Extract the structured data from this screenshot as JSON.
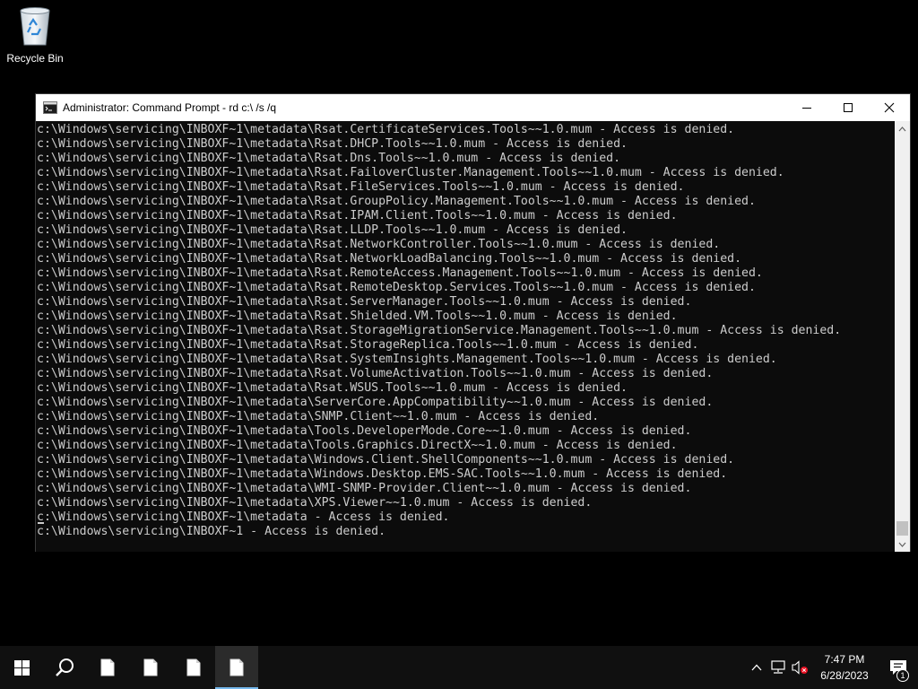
{
  "desktop": {
    "icons": [
      {
        "label": "Recycle Bin",
        "icon": "recycle-bin-icon"
      }
    ]
  },
  "window": {
    "title": "Administrator:  Command Prompt - rd  c:\\ /s /q",
    "icon": "command-prompt-icon",
    "controls": {
      "minimize": "minimize-icon",
      "maximize": "maximize-icon",
      "close": "close-icon"
    }
  },
  "console": {
    "lines": [
      "c:\\Windows\\servicing\\INBOXF~1\\metadata\\Rsat.CertificateServices.Tools~~1.0.mum - Access is denied.",
      "c:\\Windows\\servicing\\INBOXF~1\\metadata\\Rsat.DHCP.Tools~~1.0.mum - Access is denied.",
      "c:\\Windows\\servicing\\INBOXF~1\\metadata\\Rsat.Dns.Tools~~1.0.mum - Access is denied.",
      "c:\\Windows\\servicing\\INBOXF~1\\metadata\\Rsat.FailoverCluster.Management.Tools~~1.0.mum - Access is denied.",
      "c:\\Windows\\servicing\\INBOXF~1\\metadata\\Rsat.FileServices.Tools~~1.0.mum - Access is denied.",
      "c:\\Windows\\servicing\\INBOXF~1\\metadata\\Rsat.GroupPolicy.Management.Tools~~1.0.mum - Access is denied.",
      "c:\\Windows\\servicing\\INBOXF~1\\metadata\\Rsat.IPAM.Client.Tools~~1.0.mum - Access is denied.",
      "c:\\Windows\\servicing\\INBOXF~1\\metadata\\Rsat.LLDP.Tools~~1.0.mum - Access is denied.",
      "c:\\Windows\\servicing\\INBOXF~1\\metadata\\Rsat.NetworkController.Tools~~1.0.mum - Access is denied.",
      "c:\\Windows\\servicing\\INBOXF~1\\metadata\\Rsat.NetworkLoadBalancing.Tools~~1.0.mum - Access is denied.",
      "c:\\Windows\\servicing\\INBOXF~1\\metadata\\Rsat.RemoteAccess.Management.Tools~~1.0.mum - Access is denied.",
      "c:\\Windows\\servicing\\INBOXF~1\\metadata\\Rsat.RemoteDesktop.Services.Tools~~1.0.mum - Access is denied.",
      "c:\\Windows\\servicing\\INBOXF~1\\metadata\\Rsat.ServerManager.Tools~~1.0.mum - Access is denied.",
      "c:\\Windows\\servicing\\INBOXF~1\\metadata\\Rsat.Shielded.VM.Tools~~1.0.mum - Access is denied.",
      "c:\\Windows\\servicing\\INBOXF~1\\metadata\\Rsat.StorageMigrationService.Management.Tools~~1.0.mum - Access is denied.",
      "c:\\Windows\\servicing\\INBOXF~1\\metadata\\Rsat.StorageReplica.Tools~~1.0.mum - Access is denied.",
      "c:\\Windows\\servicing\\INBOXF~1\\metadata\\Rsat.SystemInsights.Management.Tools~~1.0.mum - Access is denied.",
      "c:\\Windows\\servicing\\INBOXF~1\\metadata\\Rsat.VolumeActivation.Tools~~1.0.mum - Access is denied.",
      "c:\\Windows\\servicing\\INBOXF~1\\metadata\\Rsat.WSUS.Tools~~1.0.mum - Access is denied.",
      "c:\\Windows\\servicing\\INBOXF~1\\metadata\\ServerCore.AppCompatibility~~1.0.mum - Access is denied.",
      "c:\\Windows\\servicing\\INBOXF~1\\metadata\\SNMP.Client~~1.0.mum - Access is denied.",
      "c:\\Windows\\servicing\\INBOXF~1\\metadata\\Tools.DeveloperMode.Core~~1.0.mum - Access is denied.",
      "c:\\Windows\\servicing\\INBOXF~1\\metadata\\Tools.Graphics.DirectX~~1.0.mum - Access is denied.",
      "c:\\Windows\\servicing\\INBOXF~1\\metadata\\Windows.Client.ShellComponents~~1.0.mum - Access is denied.",
      "c:\\Windows\\servicing\\INBOXF~1\\metadata\\Windows.Desktop.EMS-SAC.Tools~~1.0.mum - Access is denied.",
      "c:\\Windows\\servicing\\INBOXF~1\\metadata\\WMI-SNMP-Provider.Client~~1.0.mum - Access is denied.",
      "c:\\Windows\\servicing\\INBOXF~1\\metadata\\XPS.Viewer~~1.0.mum - Access is denied.",
      "c:\\Windows\\servicing\\INBOXF~1\\metadata - Access is denied.",
      "c:\\Windows\\servicing\\INBOXF~1 - Access is denied."
    ],
    "text_color": "#cccccc",
    "background": "#0c0c0c",
    "scroll_position": 0.97
  },
  "taskbar": {
    "items": [
      {
        "name": "start-button",
        "icon": "windows-logo-icon"
      },
      {
        "name": "search-button",
        "icon": "search-icon"
      },
      {
        "name": "taskbar-file-1",
        "icon": "file-icon"
      },
      {
        "name": "taskbar-file-2",
        "icon": "file-icon"
      },
      {
        "name": "taskbar-file-3",
        "icon": "file-icon"
      },
      {
        "name": "taskbar-file-4",
        "icon": "file-icon",
        "active": true
      }
    ],
    "tray": {
      "icons": [
        "chevron-up-icon",
        "network-icon",
        "volume-muted-icon"
      ],
      "time": "7:47 PM",
      "date": "6/28/2023",
      "notification_count": "1"
    },
    "accent": "#76b9ed"
  }
}
